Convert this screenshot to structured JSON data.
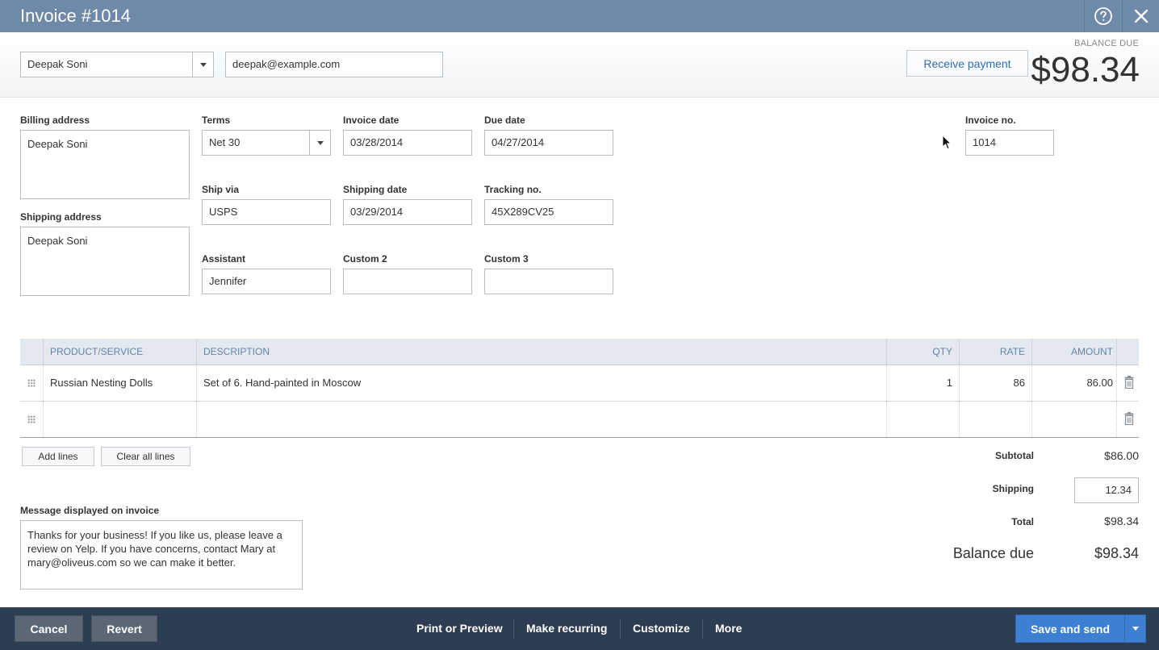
{
  "window": {
    "title": "Invoice #1014"
  },
  "customer": {
    "name": "Deepak Soni",
    "email": "deepak@example.com"
  },
  "receive_payment_label": "Receive payment",
  "balance": {
    "label": "BALANCE DUE",
    "amount": "$98.34"
  },
  "fields": {
    "billing_address": {
      "label": "Billing address",
      "value": "Deepak Soni"
    },
    "shipping_address": {
      "label": "Shipping address",
      "value": "Deepak Soni"
    },
    "terms": {
      "label": "Terms",
      "value": "Net 30"
    },
    "invoice_date": {
      "label": "Invoice date",
      "value": "03/28/2014"
    },
    "due_date": {
      "label": "Due date",
      "value": "04/27/2014"
    },
    "invoice_no": {
      "label": "Invoice no.",
      "value": "1014"
    },
    "ship_via": {
      "label": "Ship via",
      "value": "USPS"
    },
    "shipping_date": {
      "label": "Shipping date",
      "value": "03/29/2014"
    },
    "tracking_no": {
      "label": "Tracking no.",
      "value": "45X289CV25"
    },
    "assistant": {
      "label": "Assistant",
      "value": "Jennifer"
    },
    "custom2": {
      "label": "Custom 2",
      "value": ""
    },
    "custom3": {
      "label": "Custom 3",
      "value": ""
    }
  },
  "table": {
    "headers": {
      "product": "PRODUCT/SERVICE",
      "description": "DESCRIPTION",
      "qty": "QTY",
      "rate": "RATE",
      "amount": "AMOUNT"
    },
    "rows": [
      {
        "product": "Russian Nesting Dolls",
        "description": "Set of 6. Hand-painted in Moscow",
        "qty": "1",
        "rate": "86",
        "amount": "86.00"
      },
      {
        "product": "",
        "description": "",
        "qty": "",
        "rate": "",
        "amount": ""
      }
    ]
  },
  "line_buttons": {
    "add": "Add lines",
    "clear": "Clear all lines"
  },
  "message": {
    "label": "Message displayed on invoice",
    "value": "Thanks for your business! If you like us, please leave a review on Yelp. If you have concerns, contact Mary at mary@oliveus.com so we can make it better."
  },
  "totals": {
    "subtotal_label": "Subtotal",
    "subtotal": "$86.00",
    "shipping_label": "Shipping",
    "shipping": "12.34",
    "total_label": "Total",
    "total": "$98.34",
    "balance_label": "Balance due",
    "balance": "$98.34"
  },
  "footer": {
    "cancel": "Cancel",
    "revert": "Revert",
    "print_preview": "Print or Preview",
    "make_recurring": "Make recurring",
    "customize": "Customize",
    "more": "More",
    "save_send": "Save and send"
  },
  "colors": {
    "title_bar": "#6e8aa8",
    "footer": "#2d3e52",
    "primary": "#3d7fd3",
    "link": "#2f6db4"
  }
}
